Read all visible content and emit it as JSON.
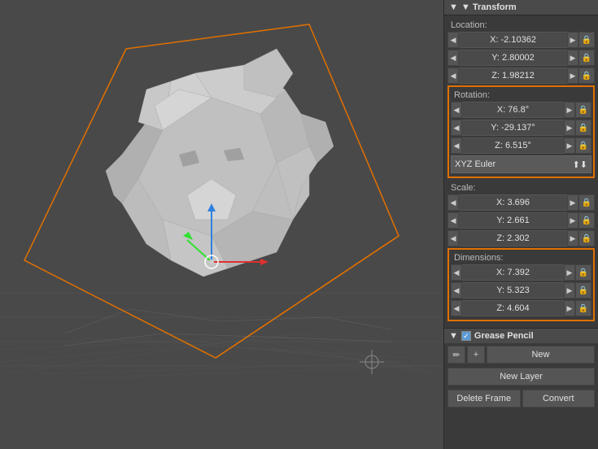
{
  "viewport": {
    "background": "#494949"
  },
  "panel": {
    "transform_header": "▼ Transform",
    "location_label": "Location:",
    "location_x": "X: -2.10362",
    "location_y": "Y: 2.80002",
    "location_z": "Z: 1.98212",
    "rotation_label": "Rotation:",
    "rotation_x": "X: 76.8°",
    "rotation_y": "Y: -29.137°",
    "rotation_z": "Z: 6.515°",
    "euler_mode": "XYZ Euler",
    "scale_label": "Scale:",
    "scale_x": "X: 3.696",
    "scale_y": "Y: 2.661",
    "scale_z": "Z: 2.302",
    "dimensions_label": "Dimensions:",
    "dim_x": "X: 7.392",
    "dim_y": "Y: 5.323",
    "dim_z": "Z: 4.604",
    "grease_pencil_header": "▼ Grease Pencil",
    "new_label": "New",
    "new_layer_label": "New Layer",
    "delete_frame_label": "Delete Frame",
    "convert_label": "Convert",
    "pencil_icon": "✏",
    "plus_icon": "+"
  }
}
